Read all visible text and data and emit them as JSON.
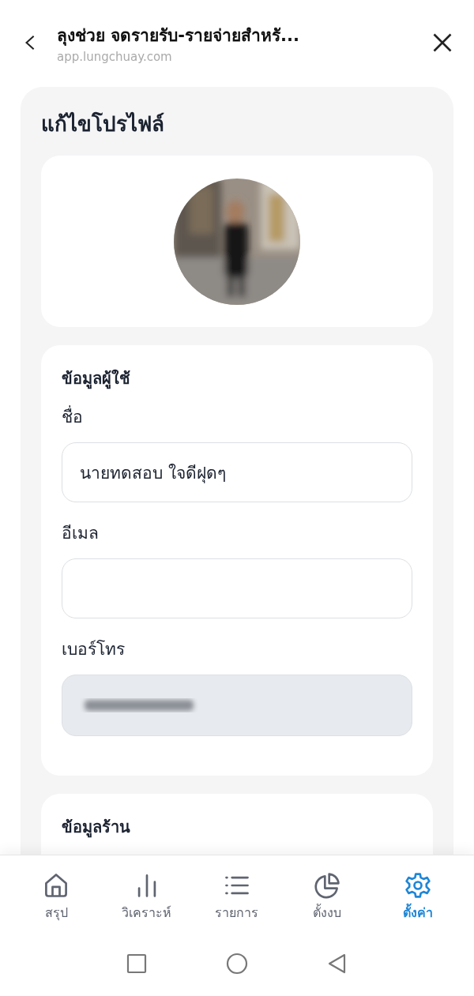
{
  "header": {
    "title": "ลุงช่วย จดรายรับ-รายจ่ายสำหรั...",
    "url": "app.lungchuay.com"
  },
  "page_title": "แก้ไขโปรไฟล์",
  "sections": [
    {
      "title": "ข้อมูลผู้ใช้",
      "fields": [
        {
          "label": "ชื่อ",
          "value": "นายทดสอบ ใจดีฝุดๆ",
          "disabled": false
        },
        {
          "label": "อีเมล",
          "disabled": false
        },
        {
          "label": "เบอร์โทร",
          "disabled": true,
          "redacted": true
        }
      ]
    },
    {
      "title": "ข้อมูลร้าน"
    }
  ],
  "nav": [
    {
      "label": "สรุป",
      "kind": "home",
      "selected": false
    },
    {
      "label": "วิเคราะห์",
      "kind": "chart",
      "selected": false
    },
    {
      "label": "รายการ",
      "kind": "list",
      "selected": false
    },
    {
      "label": "ตั้งงบ",
      "kind": "pie",
      "selected": false
    },
    {
      "label": "ตั้งค่า",
      "kind": "settings",
      "selected": true
    }
  ]
}
